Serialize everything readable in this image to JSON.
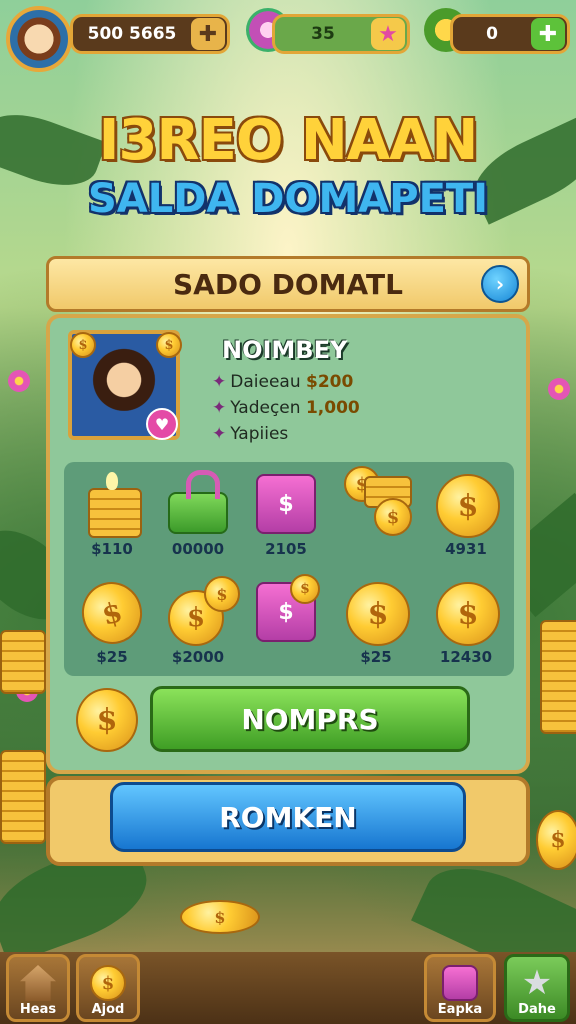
{
  "colors": {
    "gold": "#ffd23a",
    "title_blue": "#3fb6f0",
    "panel_green": "#8fc89a",
    "button_green": "#3f9e25",
    "button_blue": "#1776d0"
  },
  "topbar": {
    "coins_value": "500 5665",
    "coins_plus_icon": "plus-icon",
    "gems_value": "35",
    "gems_icon": "flower-icon",
    "gems_star_icon": "star-icon",
    "energy_value": "0",
    "energy_icon": "leaf-icon",
    "energy_plus_icon": "plus-icon"
  },
  "title": {
    "line1": "I3REO NAAN",
    "line2": "SALDA DOMAPETI"
  },
  "panel": {
    "header": "SADO DOMATL",
    "header_icon": "chevron-right-icon",
    "profile_name": "NOIMBEY",
    "stats": [
      {
        "label": "Daieeau",
        "value": "$200"
      },
      {
        "label": "Yadeçen",
        "value": "1,000"
      },
      {
        "label": "Yapiies",
        "value": ""
      }
    ],
    "items": [
      {
        "icon": "coin-stack-icon",
        "price": "$110"
      },
      {
        "icon": "lock-icon",
        "price": "00000"
      },
      {
        "icon": "gift-box-icon",
        "price": "2105"
      },
      {
        "icon": "coin-pile-icon",
        "price": ""
      },
      {
        "icon": "coin-icon",
        "price": "4931"
      },
      {
        "icon": "coin-icon",
        "price": "$25"
      },
      {
        "icon": "coin-pair-icon",
        "price": "$2000"
      },
      {
        "icon": "gift-box-icon",
        "price": ""
      },
      {
        "icon": "coin-icon",
        "price": "$25"
      },
      {
        "icon": "coin-icon",
        "price": "12430"
      }
    ],
    "primary_button": "NOMPRS",
    "secondary_button": "ROMKEN"
  },
  "nav": {
    "items": [
      {
        "icon": "house-icon",
        "label": "Heas"
      },
      {
        "icon": "coin-icon",
        "label": "Ajod"
      },
      {
        "icon": "gift-box-icon",
        "label": "Eapka"
      },
      {
        "icon": "star-icon",
        "label": "Dahe"
      }
    ]
  }
}
